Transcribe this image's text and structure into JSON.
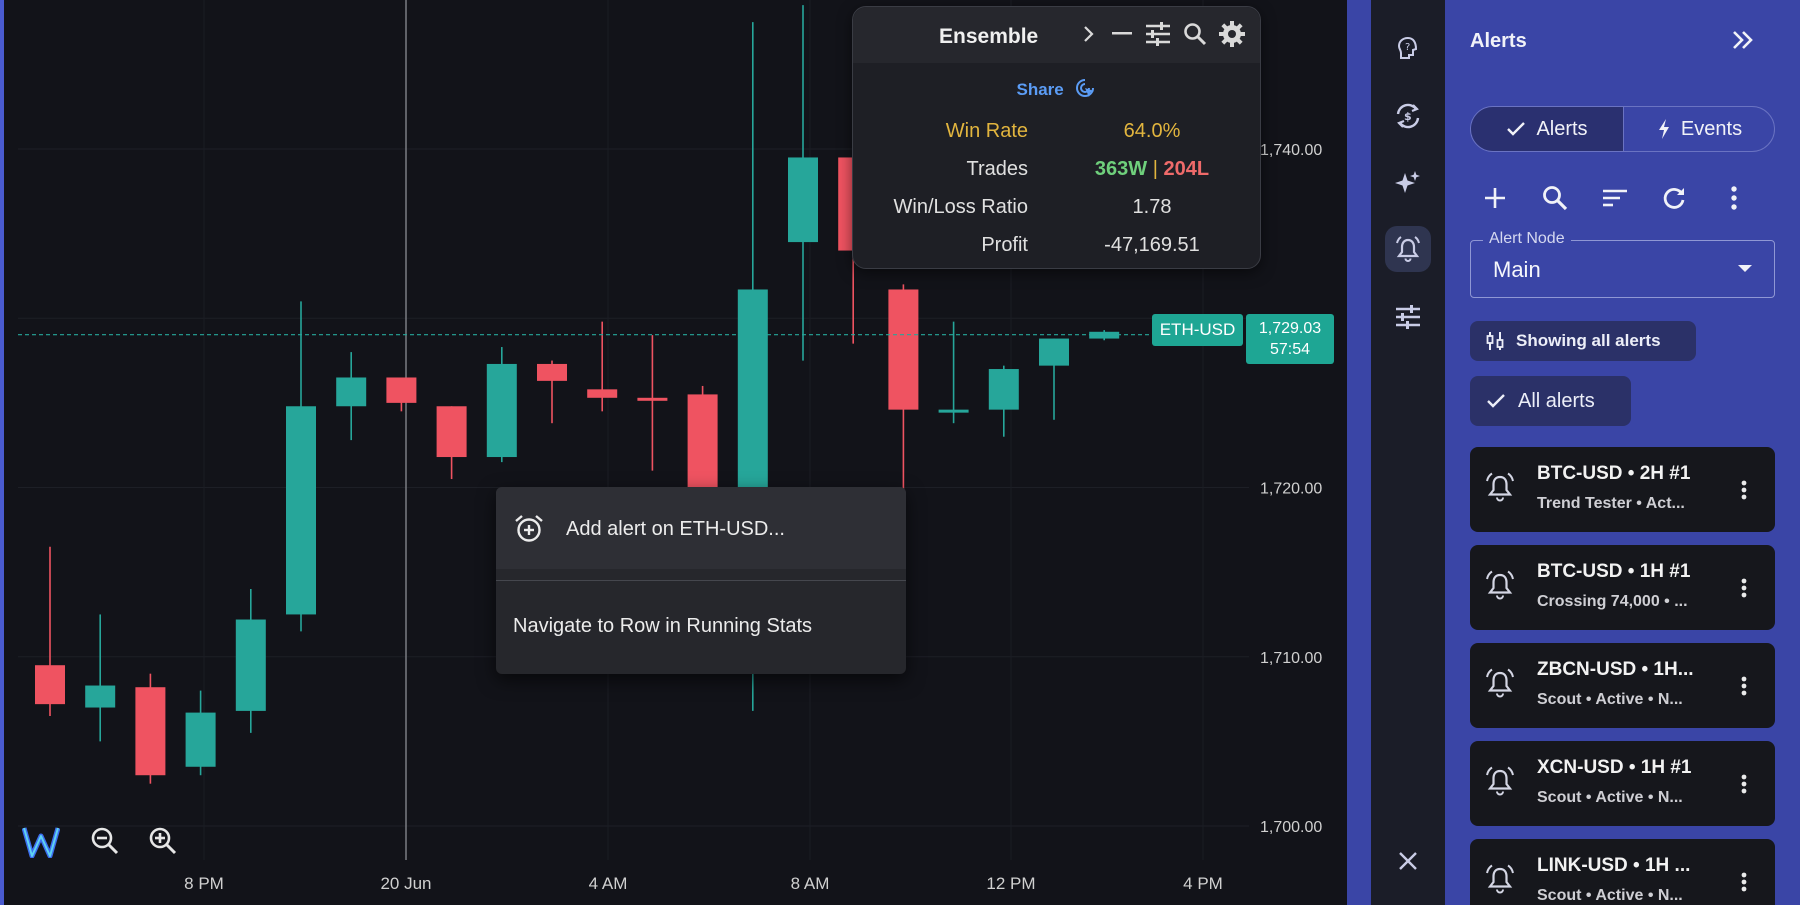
{
  "chart": {
    "symbol_tag": "ETH-USD",
    "price": "1,729.03",
    "countdown": "57:54",
    "price_labels": [
      "1,740.00",
      "1,720.00",
      "1,710.00",
      "1,700.00"
    ],
    "time_labels": [
      "8 PM",
      "20 Jun",
      "4 AM",
      "8 AM",
      "12 PM",
      "4 PM"
    ],
    "up_color": "#26a69a",
    "down_color": "#ef5361",
    "candles": [
      {
        "o": 1709.5,
        "h": 1716.5,
        "l": 1706.5,
        "c": 1707.2
      },
      {
        "o": 1707.0,
        "h": 1712.5,
        "l": 1705.0,
        "c": 1708.3
      },
      {
        "o": 1708.2,
        "h": 1709.0,
        "l": 1702.5,
        "c": 1703.0
      },
      {
        "o": 1703.5,
        "h": 1708.0,
        "l": 1703.0,
        "c": 1706.7
      },
      {
        "o": 1706.8,
        "h": 1714.0,
        "l": 1705.5,
        "c": 1712.2
      },
      {
        "o": 1712.5,
        "h": 1731.0,
        "l": 1711.5,
        "c": 1724.8
      },
      {
        "o": 1724.8,
        "h": 1728.0,
        "l": 1722.8,
        "c": 1726.5
      },
      {
        "o": 1726.5,
        "h": 1726.5,
        "l": 1724.5,
        "c": 1725.0
      },
      {
        "o": 1724.8,
        "h": 1724.8,
        "l": 1720.5,
        "c": 1721.8
      },
      {
        "o": 1721.8,
        "h": 1728.3,
        "l": 1721.5,
        "c": 1727.3
      },
      {
        "o": 1727.3,
        "h": 1727.5,
        "l": 1723.8,
        "c": 1726.3
      },
      {
        "o": 1725.8,
        "h": 1729.8,
        "l": 1724.5,
        "c": 1725.3
      },
      {
        "o": 1725.3,
        "h": 1729.0,
        "l": 1721.0,
        "c": 1725.2
      },
      {
        "o": 1725.5,
        "h": 1726.0,
        "l": 1719.0,
        "c": 1719.5
      },
      {
        "o": 1719.5,
        "h": 1747.5,
        "l": 1706.8,
        "c": 1731.7
      },
      {
        "o": 1734.5,
        "h": 1748.5,
        "l": 1727.5,
        "c": 1739.5
      },
      {
        "o": 1739.5,
        "h": 1740.0,
        "l": 1728.5,
        "c": 1734.0
      },
      {
        "o": 1731.7,
        "h": 1732.0,
        "l": 1719.3,
        "c": 1724.6
      },
      {
        "o": 1724.6,
        "h": 1729.8,
        "l": 1723.8,
        "c": 1724.6
      },
      {
        "o": 1724.6,
        "h": 1727.2,
        "l": 1723.0,
        "c": 1727.0
      },
      {
        "o": 1727.2,
        "h": 1728.8,
        "l": 1724.0,
        "c": 1728.8
      },
      {
        "o": 1728.8,
        "h": 1729.3,
        "l": 1728.7,
        "c": 1729.2
      }
    ]
  },
  "stats": {
    "title": "Ensemble",
    "share_label": "Share",
    "win_rate_label": "Win Rate",
    "win_rate_value": "64.0%",
    "trades_label": "Trades",
    "trades_wins": "363W",
    "trades_sep": "|",
    "trades_losses": "204L",
    "ratio_label": "Win/Loss Ratio",
    "ratio_value": "1.78",
    "profit_label": "Profit",
    "profit_value": "-47,169.51"
  },
  "context_menu": {
    "add_alert": "Add alert on ETH-USD...",
    "navigate": "Navigate to Row in Running Stats"
  },
  "alerts_panel": {
    "title": "Alerts",
    "tab_alerts": "Alerts",
    "tab_events": "Events",
    "node_label": "Alert Node",
    "node_value": "Main",
    "showing_chip": "Showing all alerts",
    "all_chip": "All alerts",
    "items": [
      {
        "title": "BTC-USD • 2H #1",
        "subtitle": "Trend Tester • Act..."
      },
      {
        "title": "BTC-USD • 1H #1",
        "subtitle": "Crossing 74,000 • ..."
      },
      {
        "title": "ZBCN-USD • 1H...",
        "subtitle": "Scout • Active • N..."
      },
      {
        "title": "XCN-USD • 1H #1",
        "subtitle": "Scout • Active • N..."
      },
      {
        "title": "LINK-USD • 1H ...",
        "subtitle": "Scout • Active • N..."
      }
    ]
  },
  "icons": {
    "rail": [
      "help-brain-icon",
      "exchange-icon",
      "sparkle-icon",
      "alarm-bell-icon",
      "sliders-icon",
      "close-icon"
    ],
    "stats_header": [
      "chevron-right-icon",
      "minimize-icon",
      "sliders-icon",
      "search-icon",
      "gear-icon"
    ],
    "alerts_toolbar": [
      "plus-icon",
      "search-icon",
      "sort-icon",
      "refresh-icon",
      "more-vert-icon"
    ]
  }
}
